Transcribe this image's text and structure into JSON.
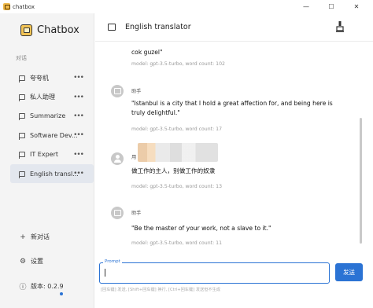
{
  "window": {
    "title": "chatbox",
    "minimize": "—",
    "maximize": "☐",
    "close": "✕"
  },
  "sidebar": {
    "app_name": "Chatbox",
    "section_label": "对话",
    "items": [
      {
        "label": "夸夸机",
        "active": false
      },
      {
        "label": "私人助理",
        "active": false
      },
      {
        "label": "Summarize",
        "active": false
      },
      {
        "label": "Software Dev...",
        "active": false
      },
      {
        "label": "IT Expert",
        "active": false
      },
      {
        "label": "English transl...",
        "active": true
      }
    ],
    "more_icon": "•••",
    "new_chat": "新对话",
    "settings": "设置",
    "version": "版本: 0.2.9"
  },
  "header": {
    "title": "English translator"
  },
  "messages": [
    {
      "text": "cok guzel\"",
      "meta": "model: gpt-3.5-turbo, word count: 102"
    },
    {
      "role": "助手",
      "text": "\"Istanbul is a city that I hold a great affection for, and being here is truly delightful.\"",
      "meta": "model: gpt-3.5-turbo, word count: 17"
    },
    {
      "role": "用",
      "text": "做工作的主人，别做工作的奴隶",
      "meta": "model: gpt-3.5-turbo, word count: 13"
    },
    {
      "role": "助手",
      "text": "\"Be the master of your work, not a slave to it.\"",
      "meta": "model: gpt-3.5-turbo, word count: 11"
    }
  ],
  "input": {
    "legend": "Prompt",
    "value": "",
    "send_label": "发送",
    "hint": "[回车键] 发送, [Shift+回车键] 换行, [Ctrl+回车键] 发送但不生成"
  },
  "colors": {
    "accent": "#2b73d4",
    "sidebar_bg": "#f4f4f4",
    "active_item": "#e3e7ee"
  }
}
